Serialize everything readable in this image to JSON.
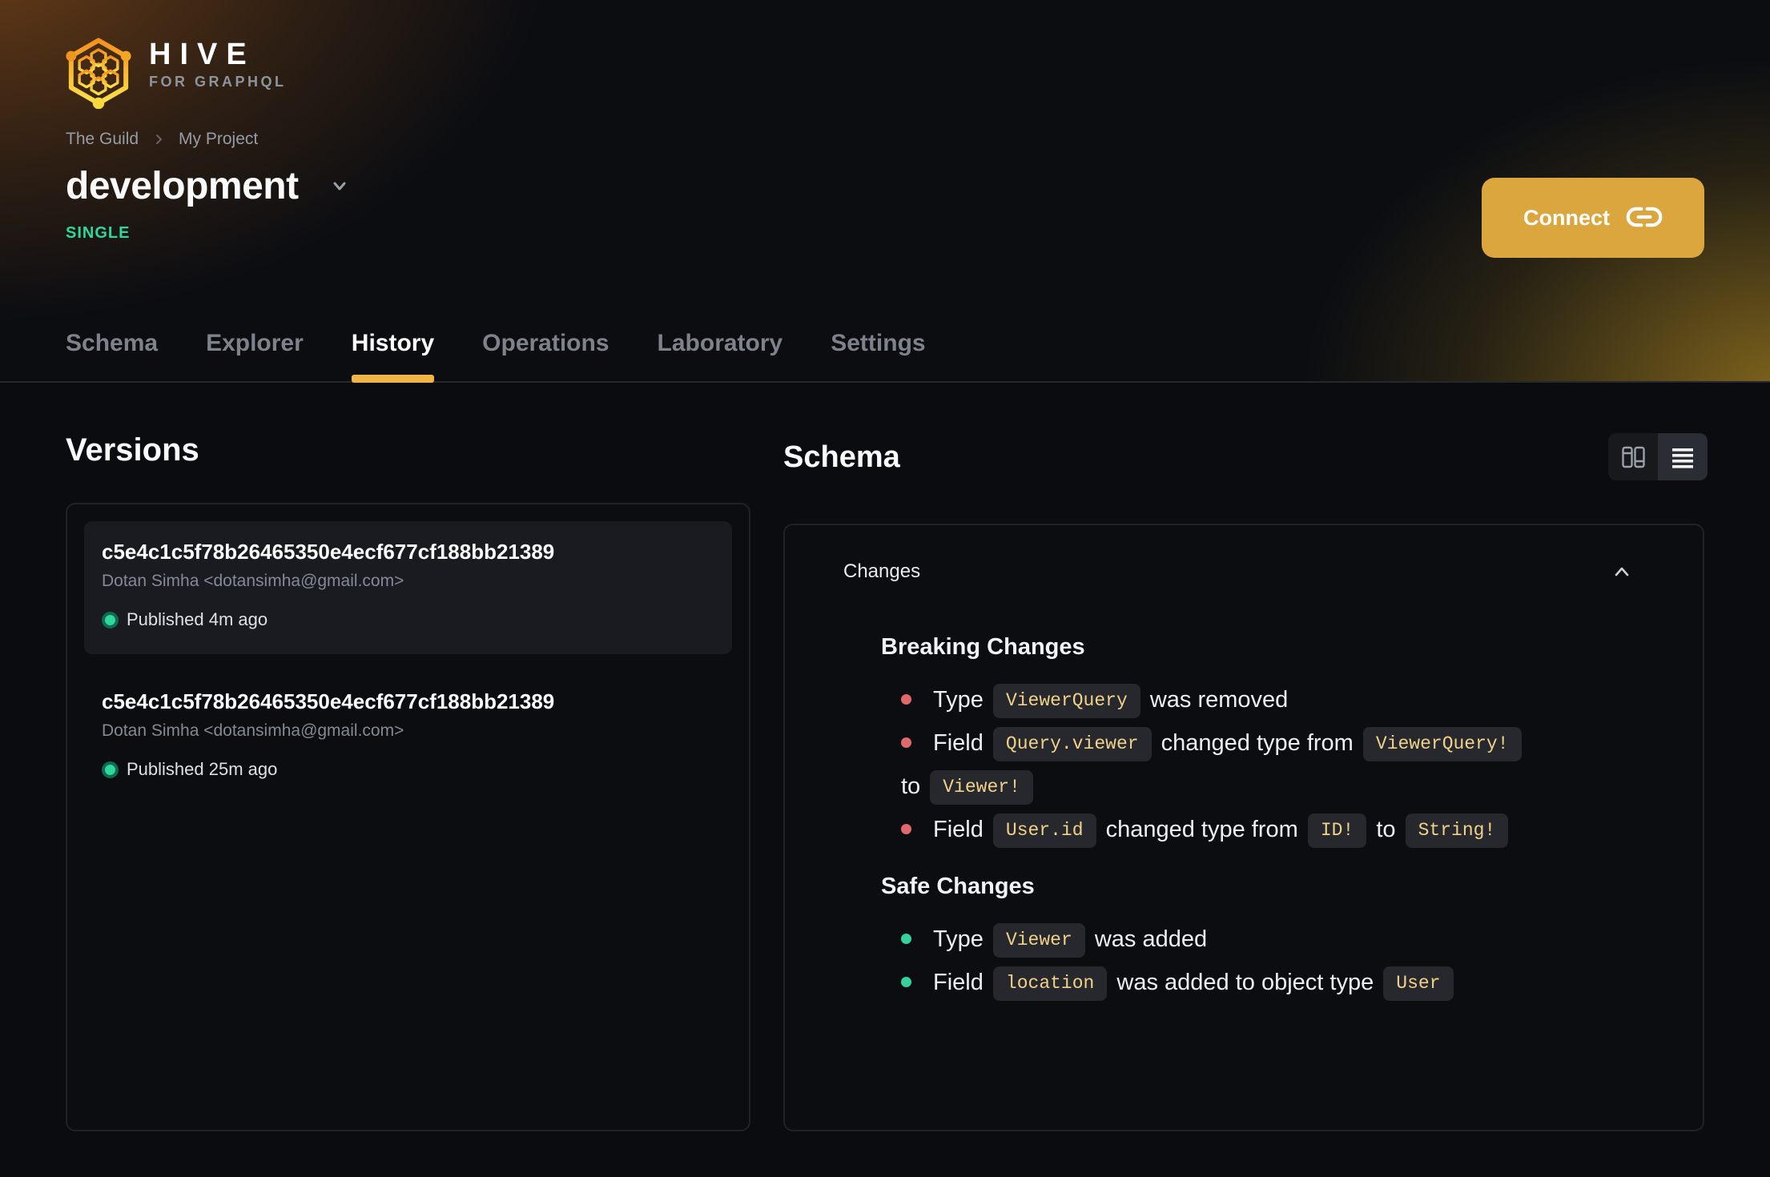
{
  "colors": {
    "accent_amber": "#f1b545",
    "connect_amber": "#dca63f",
    "breaking_red": "#e0696e",
    "safe_green": "#34d39b",
    "badge_green": "#2fd79a",
    "chip_text": "#f0d189",
    "chip_bg": "#26282d"
  },
  "brand": {
    "name": "HIVE",
    "tagline": "FOR GRAPHQL"
  },
  "breadcrumb": {
    "org": "The Guild",
    "project": "My Project"
  },
  "target": {
    "name": "development",
    "type_badge": "SINGLE"
  },
  "connect": {
    "label": "Connect"
  },
  "tabs": [
    {
      "label": "Schema",
      "active": false
    },
    {
      "label": "Explorer",
      "active": false
    },
    {
      "label": "History",
      "active": true
    },
    {
      "label": "Operations",
      "active": false
    },
    {
      "label": "Laboratory",
      "active": false
    },
    {
      "label": "Settings",
      "active": false
    }
  ],
  "versions": {
    "title": "Versions",
    "items": [
      {
        "hash": "c5e4c1c5f78b26465350e4ecf677cf188bb21389",
        "author": "Dotan Simha <dotansimha@gmail.com>",
        "status": "Published 4m ago",
        "highlighted": true
      },
      {
        "hash": "c5e4c1c5f78b26465350e4ecf677cf188bb21389",
        "author": "Dotan Simha <dotansimha@gmail.com>",
        "status": "Published 25m ago",
        "highlighted": false
      }
    ]
  },
  "schema_panel": {
    "title": "Schema",
    "section_label": "Changes",
    "active_view": "list",
    "groups": [
      {
        "title": "Breaking Changes",
        "severity": "breaking",
        "items": [
          {
            "lines": [
              [
                {
                  "t": "text",
                  "v": "Type "
                },
                {
                  "t": "code",
                  "v": "ViewerQuery"
                },
                {
                  "t": "text",
                  "v": " was removed"
                }
              ]
            ]
          },
          {
            "lines": [
              [
                {
                  "t": "text",
                  "v": "Field "
                },
                {
                  "t": "code",
                  "v": "Query.viewer"
                },
                {
                  "t": "text",
                  "v": " changed type from "
                },
                {
                  "t": "code",
                  "v": "ViewerQuery!"
                }
              ],
              [
                {
                  "t": "text",
                  "v": "to "
                },
                {
                  "t": "code",
                  "v": "Viewer!"
                }
              ]
            ]
          },
          {
            "lines": [
              [
                {
                  "t": "text",
                  "v": "Field "
                },
                {
                  "t": "code",
                  "v": "User.id"
                },
                {
                  "t": "text",
                  "v": " changed type from "
                },
                {
                  "t": "code",
                  "v": "ID!"
                },
                {
                  "t": "text",
                  "v": " to "
                },
                {
                  "t": "code",
                  "v": "String!"
                }
              ]
            ]
          }
        ]
      },
      {
        "title": "Safe Changes",
        "severity": "safe",
        "items": [
          {
            "lines": [
              [
                {
                  "t": "text",
                  "v": "Type "
                },
                {
                  "t": "code",
                  "v": "Viewer"
                },
                {
                  "t": "text",
                  "v": " was added"
                }
              ]
            ]
          },
          {
            "lines": [
              [
                {
                  "t": "text",
                  "v": "Field "
                },
                {
                  "t": "code",
                  "v": "location"
                },
                {
                  "t": "text",
                  "v": " was added to object type "
                },
                {
                  "t": "code",
                  "v": "User"
                }
              ]
            ]
          }
        ]
      }
    ]
  }
}
